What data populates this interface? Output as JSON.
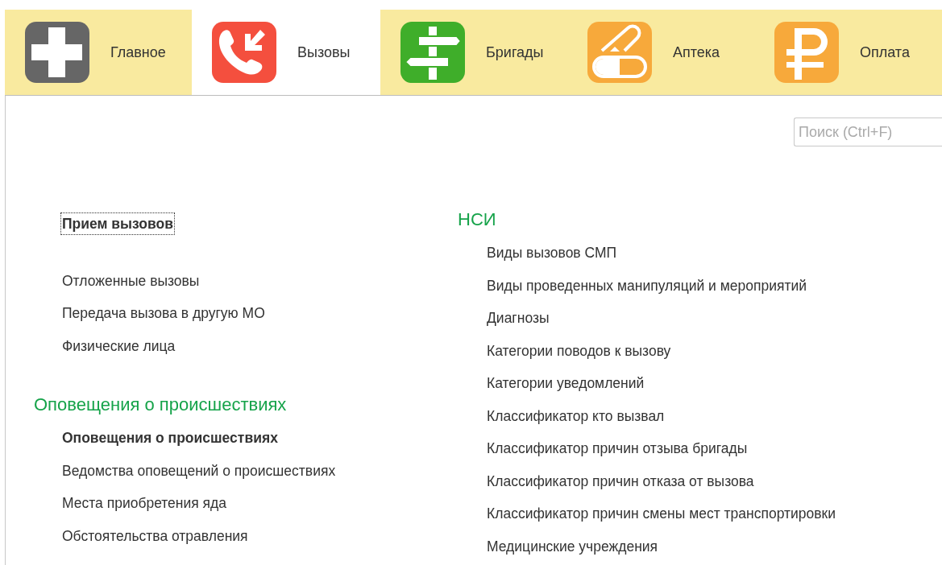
{
  "tabs": [
    {
      "label": "Главное",
      "selected": false
    },
    {
      "label": "Вызовы",
      "selected": true
    },
    {
      "label": "Бригады",
      "selected": false
    },
    {
      "label": "Аптека",
      "selected": false
    },
    {
      "label": "Оплата",
      "selected": false
    }
  ],
  "search": {
    "placeholder": "Поиск (Ctrl+F)"
  },
  "left_column": [
    {
      "items": [
        {
          "label": "Прием вызовов",
          "bold": true,
          "focused": true
        }
      ]
    },
    {
      "items": [
        {
          "label": "Отложенные вызовы",
          "bold": false,
          "focused": false
        },
        {
          "label": "Передача вызова в другую МО",
          "bold": false,
          "focused": false
        },
        {
          "label": "Физические лица",
          "bold": false,
          "focused": false
        }
      ]
    },
    {
      "heading": "Оповещения о происшествиях",
      "items": [
        {
          "label": "Оповещения о происшествиях",
          "bold": true,
          "focused": false
        },
        {
          "label": "Ведомства оповещений о происшествиях",
          "bold": false,
          "focused": false
        },
        {
          "label": "Места приобретения яда",
          "bold": false,
          "focused": false
        },
        {
          "label": "Обстоятельства отравления",
          "bold": false,
          "focused": false
        }
      ]
    }
  ],
  "right_column": [
    {
      "heading": "НСИ",
      "items": [
        {
          "label": "Виды вызовов СМП",
          "bold": false,
          "focused": false
        },
        {
          "label": "Виды проведенных манипуляций и мероприятий",
          "bold": false,
          "focused": false
        },
        {
          "label": "Диагнозы",
          "bold": false,
          "focused": false
        },
        {
          "label": "Категории поводов к вызову",
          "bold": false,
          "focused": false
        },
        {
          "label": "Категории уведомлений",
          "bold": false,
          "focused": false
        },
        {
          "label": "Классификатор кто вызвал",
          "bold": false,
          "focused": false
        },
        {
          "label": "Классификатор причин отзыва бригады",
          "bold": false,
          "focused": false
        },
        {
          "label": "Классификатор причин отказа от вызова",
          "bold": false,
          "focused": false
        },
        {
          "label": "Классификатор причин смены мест транспортировки",
          "bold": false,
          "focused": false
        },
        {
          "label": "Медицинские учреждения",
          "bold": false,
          "focused": false
        }
      ]
    }
  ]
}
